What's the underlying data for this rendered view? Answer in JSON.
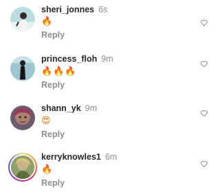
{
  "comments": [
    {
      "username": "sheri_jonnes",
      "time": "6s",
      "text": "🔥",
      "reply_label": "Reply"
    },
    {
      "username": "princess_floh",
      "time": "9m",
      "text": "🔥🔥🔥",
      "reply_label": "Reply"
    },
    {
      "username": "shann_yk",
      "time": "9m",
      "text": "😍",
      "reply_label": "Reply"
    },
    {
      "username": "kerryknowles1",
      "time": "6m",
      "text": "🔥",
      "reply_label": "Reply"
    }
  ],
  "icons": {
    "like": "heart-outline-icon"
  },
  "colors": {
    "text": "#262626",
    "muted": "#8e8e8e",
    "story_ring": [
      "#feda75",
      "#fa7e1e",
      "#d62976",
      "#962fbf",
      "#4f5bd5"
    ]
  }
}
